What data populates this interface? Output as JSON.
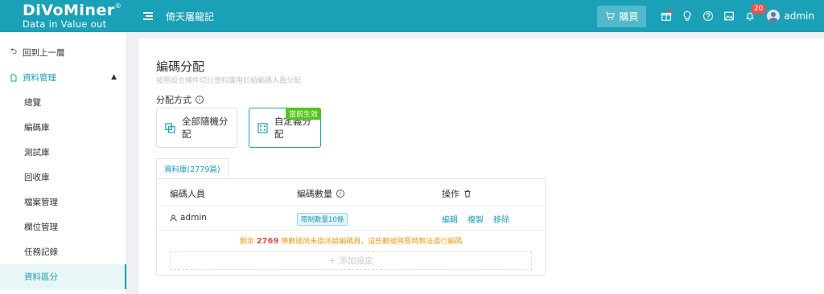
{
  "header": {
    "logo_brand": "DiVoMiner",
    "logo_reg": "®",
    "logo_tagline": "Data in  Value out",
    "project_title": "倚天屠龍記",
    "buy_label": "購買",
    "notification_count": "20",
    "username": "admin",
    "icons": [
      "menu-icon",
      "cart-icon",
      "gift-icon",
      "bulb-icon",
      "help-icon",
      "image-icon",
      "bell-icon",
      "avatar"
    ]
  },
  "sidebar": {
    "back_label": "回到上一層",
    "group_label": "資料管理",
    "items": [
      {
        "label": "總覽"
      },
      {
        "label": "編碼庫"
      },
      {
        "label": "測試庫"
      },
      {
        "label": "回收庫"
      },
      {
        "label": "檔案管理"
      },
      {
        "label": "欄位管理"
      },
      {
        "label": "任務記錄"
      },
      {
        "label": "資料區分"
      }
    ],
    "active_index": 7
  },
  "main": {
    "title": "編碼分配",
    "subtitle": "按照設立條件切分資料庫用於給編碼人員分配",
    "method_label": "分配方式",
    "modes": {
      "random": "全部隨機分配",
      "custom": "自定義分配",
      "current_tag": "當前生效"
    },
    "tab_label": "資料庫(2779篇)",
    "table": {
      "col_coder": "編碼人員",
      "col_count": "編碼數量",
      "col_ops": "操作",
      "rows": [
        {
          "coder": "admin",
          "limit": "限制數量10條",
          "edit": "編輯",
          "copy": "複製",
          "remove": "移除"
        }
      ]
    },
    "notice_prefix": "剩余",
    "notice_count": "2769",
    "notice_suffix": "條數據尚未指派給編碼員，這些數據將暫時無法進行編碼",
    "add_label": "添加設定"
  },
  "colors": {
    "accent": "#1aa1b8",
    "current_tag": "#52c41a",
    "warning": "#f39c12",
    "badge": "#f24e4e"
  }
}
